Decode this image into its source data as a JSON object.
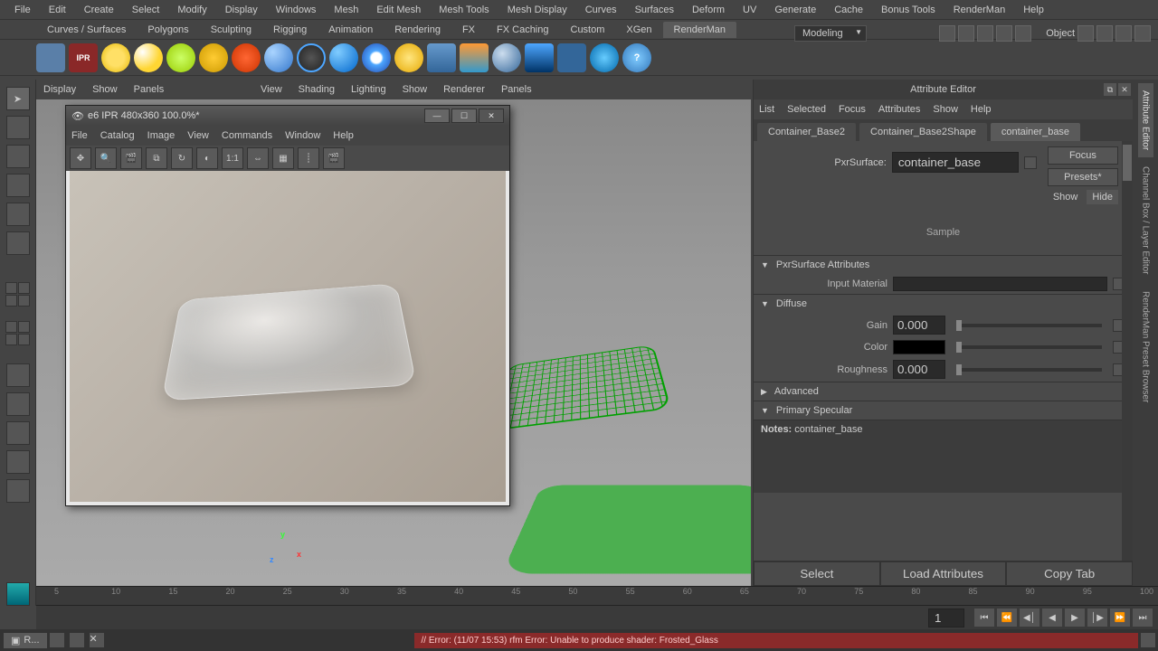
{
  "top_menu": [
    "File",
    "Edit",
    "Create",
    "Select",
    "Modify",
    "Display",
    "Windows",
    "Mesh",
    "Edit Mesh",
    "Mesh Tools",
    "Mesh Display",
    "Curves",
    "Surfaces",
    "Deform",
    "UV",
    "Generate",
    "Cache",
    "Bonus Tools",
    "RenderMan",
    "Help"
  ],
  "shelf_tabs": [
    "Curves / Surfaces",
    "Polygons",
    "Sculpting",
    "Rigging",
    "Animation",
    "Rendering",
    "FX",
    "FX Caching",
    "Custom",
    "XGen",
    "RenderMan"
  ],
  "shelf_active": "RenderMan",
  "workspace": "Modeling",
  "object_mode": "Object",
  "viewport_menu_left": [
    "Display",
    "Show",
    "Panels"
  ],
  "viewport_menu_right": [
    "View",
    "Shading",
    "Lighting",
    "Show",
    "Renderer",
    "Panels"
  ],
  "shelf_icons": [
    "clapboard",
    "ipr",
    "sphere-lambert",
    "sphere-sun",
    "sphere-env",
    "sphere-dome",
    "sphere-star",
    "sphere-matte",
    "sphere-ring",
    "sphere-key",
    "sphere-eye",
    "sphere-bulb",
    "calculator",
    "image-tool",
    "moon",
    "clapper-blue",
    "bar-chart",
    "swirl",
    "help"
  ],
  "render_window": {
    "title": "e6 IPR 480x360 100.0%*",
    "menu": [
      "File",
      "Catalog",
      "Image",
      "View",
      "Commands",
      "Window",
      "Help"
    ],
    "tool_labels": [
      "move",
      "zoom",
      "clap",
      "copy",
      "refresh",
      "pick",
      "1:1",
      "split",
      "marquee",
      "crop",
      "clap2"
    ]
  },
  "attribute_editor": {
    "title": "Attribute Editor",
    "menu": [
      "List",
      "Selected",
      "Focus",
      "Attributes",
      "Show",
      "Help"
    ],
    "tabs": [
      "Container_Base2",
      "Container_Base2Shape",
      "container_base"
    ],
    "active_tab": "container_base",
    "type_label": "PxrSurface:",
    "name_value": "container_base",
    "buttons": {
      "focus": "Focus",
      "presets": "Presets*",
      "show": "Show",
      "hide": "Hide"
    },
    "sample_label": "Sample",
    "sections": {
      "pxr": "PxrSurface Attributes",
      "input_material": "Input Material",
      "diffuse": "Diffuse",
      "advanced": "Advanced",
      "primary_spec": "Primary Specular"
    },
    "attrs": {
      "gain": {
        "label": "Gain",
        "value": "0.000"
      },
      "color": {
        "label": "Color"
      },
      "roughness": {
        "label": "Roughness",
        "value": "0.000"
      }
    },
    "notes_label": "Notes:",
    "notes_value": "container_base",
    "footer": [
      "Select",
      "Load Attributes",
      "Copy Tab"
    ]
  },
  "right_tabs": [
    "Attribute Editor",
    "Channel Box / Layer Editor",
    "RenderMan Preset Browser"
  ],
  "timeline": {
    "ticks": [
      5,
      10,
      15,
      20,
      25,
      30,
      35,
      40,
      45,
      50,
      55,
      60,
      65,
      70,
      75,
      80,
      85,
      90,
      95,
      100
    ],
    "frame": "1"
  },
  "status": {
    "app": "R...",
    "error": "// Error: (11/07 15:53) rfm Error: Unable to produce shader: Frosted_Glass"
  },
  "axis": {
    "x": "x",
    "y": "y",
    "z": "z"
  }
}
